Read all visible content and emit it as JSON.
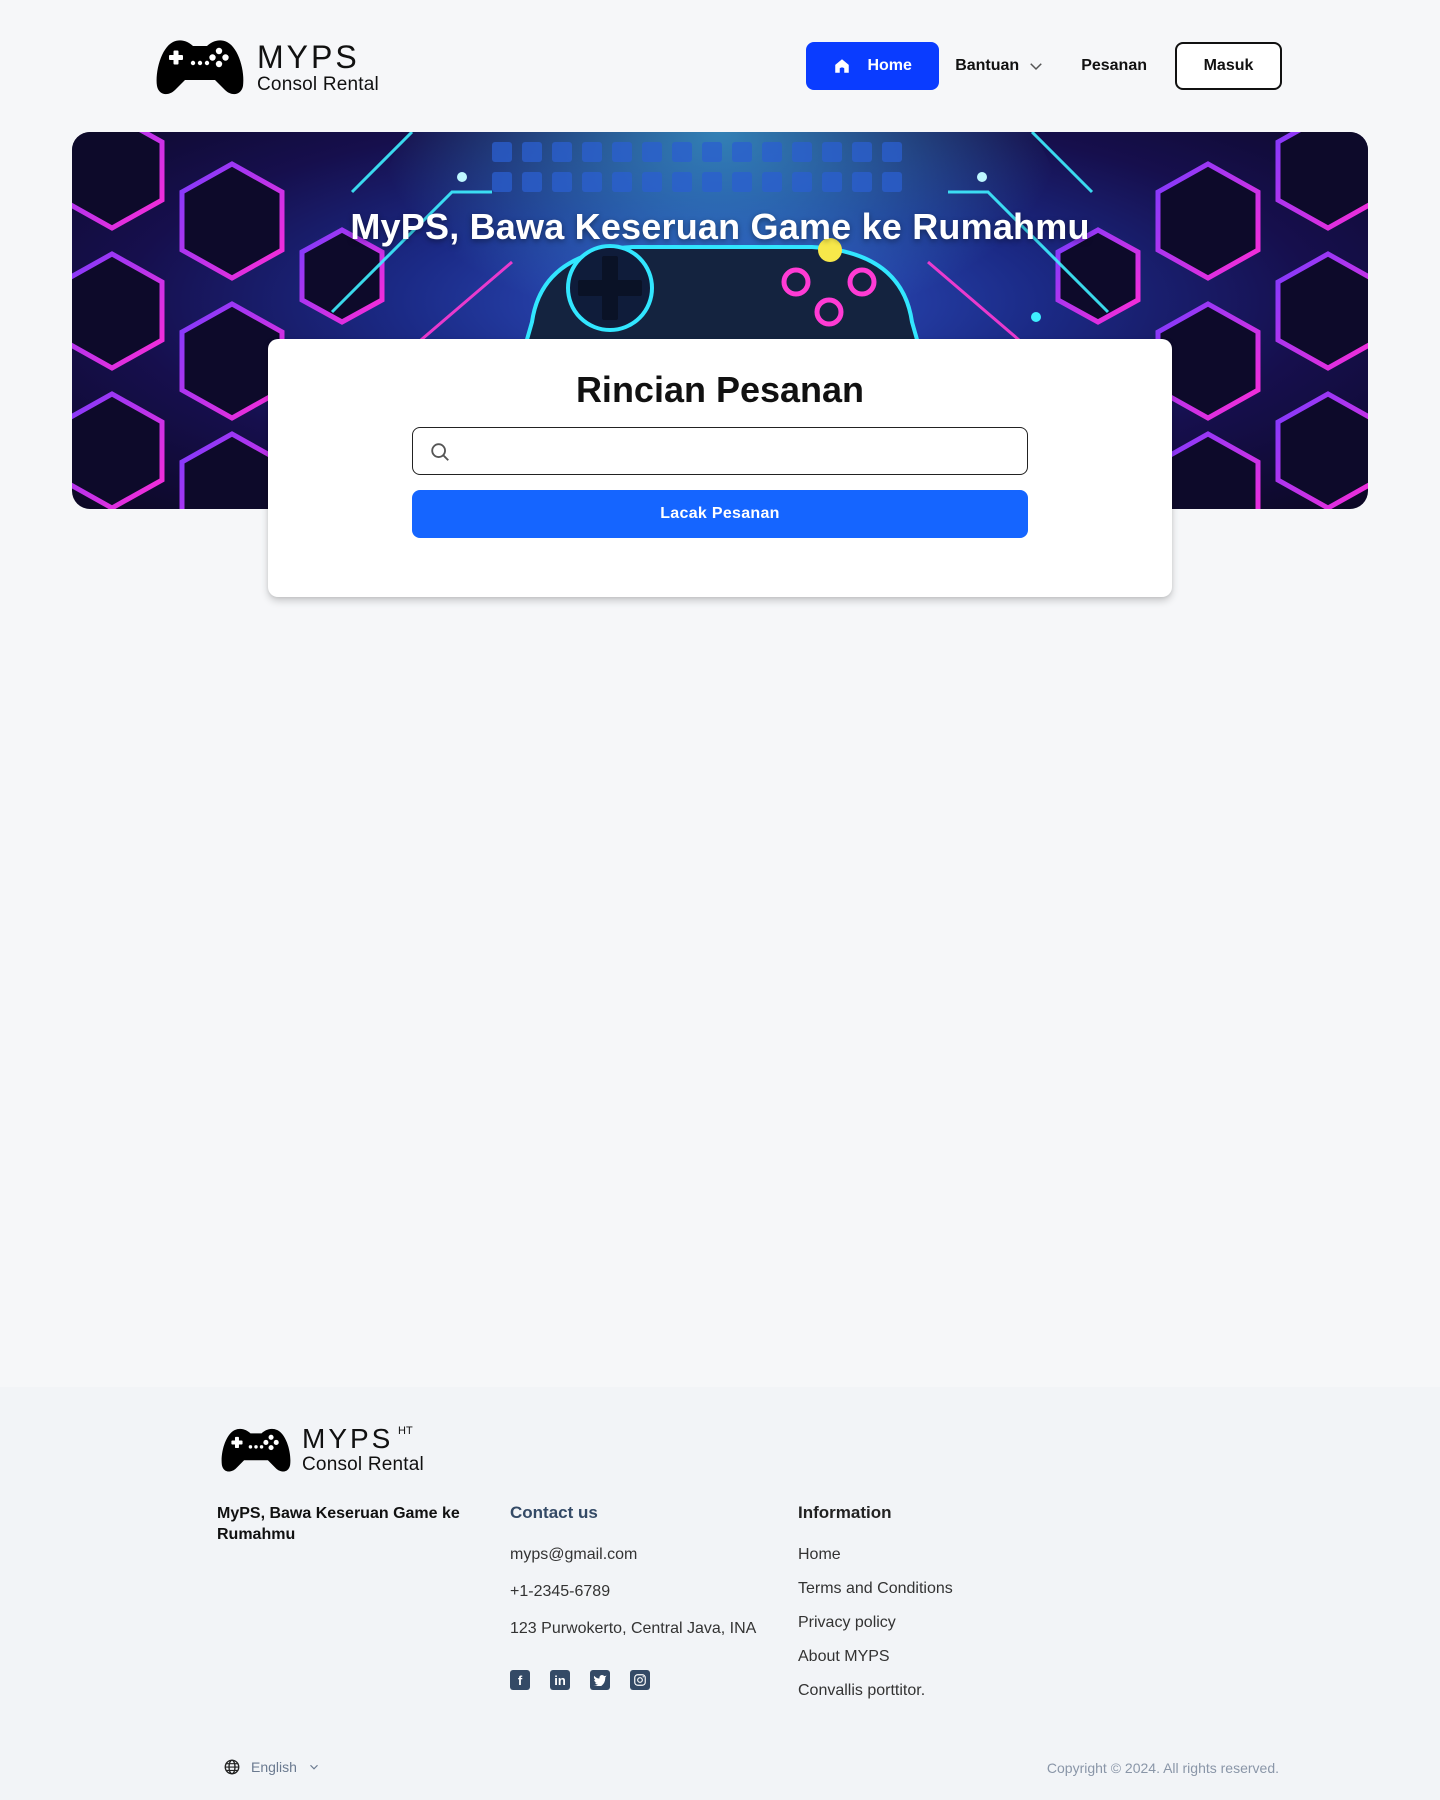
{
  "header": {
    "logo_brand": "MYPS",
    "logo_sub": "Consol Rental",
    "nav": {
      "home": "Home",
      "bantuan": "Bantuan",
      "pesanan": "Pesanan",
      "masuk": "Masuk"
    }
  },
  "hero": {
    "title": "MyPS, Bawa Keseruan Game ke Rumahmu"
  },
  "order": {
    "title": "Rincian Pesanan",
    "search_value": "",
    "track_button": "Lacak Pesanan"
  },
  "footer": {
    "logo_brand": "MYPS",
    "logo_sub": "Consol Rental",
    "logo_mark": "HT",
    "tagline": "MyPS, Bawa Keseruan Game ke Rumahmu",
    "contact": {
      "heading": "Contact us",
      "email": "myps@gmail.com",
      "phone": "+1-2345-6789",
      "address": "123 Purwokerto, Central Java, INA"
    },
    "social": [
      "facebook-icon",
      "linkedin-icon",
      "twitter-icon",
      "instagram-icon"
    ],
    "information": {
      "heading": "Information",
      "links": [
        "Home",
        "Terms and Conditions",
        "Privacy policy",
        "About MYPS",
        "Convallis porttitor."
      ]
    },
    "language": "English",
    "copyright": "Copyright © 2024. All rights reserved."
  },
  "colors": {
    "primary": "#0a3cff",
    "button": "#1565ff",
    "background": "#f6f7f9",
    "footer_bg": "#f2f4f7",
    "footer_accent": "#344a66"
  }
}
